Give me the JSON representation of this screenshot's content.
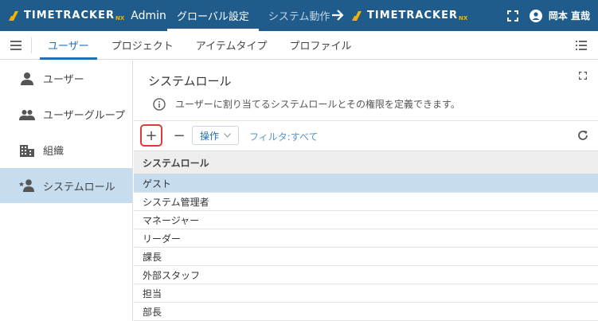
{
  "header": {
    "brand_name": "TIMETRACKER",
    "brand_suffix": "NX",
    "brand_admin": "Admin",
    "tabs": [
      {
        "label": "グローバル設定",
        "active": true
      },
      {
        "label": "システム動作",
        "active": false
      }
    ],
    "target_brand_name": "TIMETRACKER",
    "target_brand_suffix": "NX",
    "user_name": "岡本 直哉",
    "colors": {
      "bar": "#1f5c8b",
      "nx_accent": "#f4b400"
    }
  },
  "subnav": {
    "tabs": [
      {
        "label": "ユーザー",
        "active": true
      },
      {
        "label": "プロジェクト",
        "active": false
      },
      {
        "label": "アイテムタイプ",
        "active": false
      },
      {
        "label": "プロファイル",
        "active": false
      }
    ]
  },
  "sidebar": {
    "items": [
      {
        "label": "ユーザー",
        "icon": "person-icon",
        "active": false
      },
      {
        "label": "ユーザーグループ",
        "icon": "people-icon",
        "active": false
      },
      {
        "label": "組織",
        "icon": "building-icon",
        "active": false
      },
      {
        "label": "システムロール",
        "icon": "star-person-icon",
        "active": true
      }
    ]
  },
  "main": {
    "title": "システムロール",
    "info_text": "ユーザーに割り当てるシステムロールとその権限を定義できます。",
    "toolbar": {
      "add_label": "+",
      "remove_label": "−",
      "ops_label": "操作",
      "filter_label": "フィルタ:すべて"
    },
    "table": {
      "header": "システムロール",
      "rows": [
        "ゲスト",
        "システム管理者",
        "マネージャー",
        "リーダー",
        "課長",
        "外部スタッフ",
        "担当",
        "部長"
      ],
      "selected_index": 0
    }
  }
}
